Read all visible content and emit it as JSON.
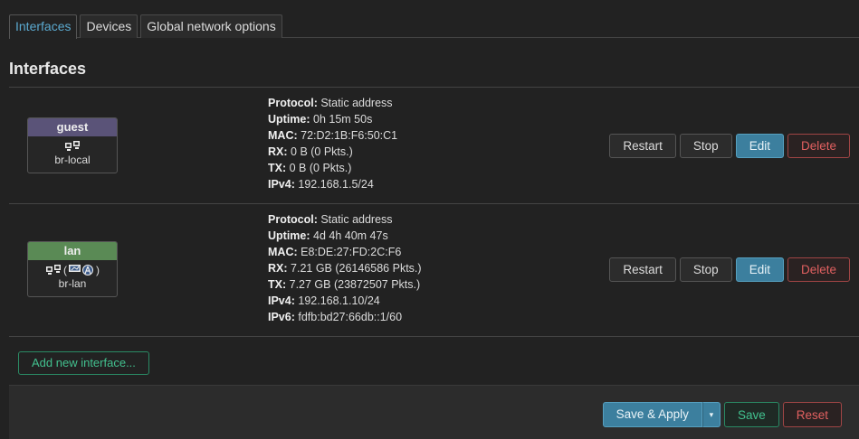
{
  "tabs": [
    {
      "label": "Interfaces",
      "active": true
    },
    {
      "label": "Devices",
      "active": false
    },
    {
      "label": "Global network options",
      "active": false
    }
  ],
  "section_title": "Interfaces",
  "interfaces": [
    {
      "name": "guest",
      "color": "#5a5378",
      "device": "br-local",
      "info": [
        {
          "label": "Protocol:",
          "value": "Static address"
        },
        {
          "label": "Uptime:",
          "value": "0h 15m 50s"
        },
        {
          "label": "MAC:",
          "value": "72:D2:1B:F6:50:C1"
        },
        {
          "label": "RX:",
          "value": "0 B (0 Pkts.)"
        },
        {
          "label": "TX:",
          "value": "0 B (0 Pkts.)"
        },
        {
          "label": "IPv4:",
          "value": "192.168.1.5/24"
        }
      ]
    },
    {
      "name": "lan",
      "color": "#5a8a55",
      "device": "br-lan",
      "info": [
        {
          "label": "Protocol:",
          "value": "Static address"
        },
        {
          "label": "Uptime:",
          "value": "4d 4h 40m 47s"
        },
        {
          "label": "MAC:",
          "value": "E8:DE:27:FD:2C:F6"
        },
        {
          "label": "RX:",
          "value": "7.21 GB (26146586 Pkts.)"
        },
        {
          "label": "TX:",
          "value": "7.27 GB (23872507 Pkts.)"
        },
        {
          "label": "IPv4:",
          "value": "192.168.1.10/24"
        },
        {
          "label": "IPv6:",
          "value": "fdfb:bd27:66db::1/60"
        }
      ]
    }
  ],
  "row_actions": {
    "restart": "Restart",
    "stop": "Stop",
    "edit": "Edit",
    "delete": "Delete"
  },
  "add_interface_label": "Add new interface...",
  "footer": {
    "save_apply": "Save & Apply",
    "caret": "▾",
    "save": "Save",
    "reset": "Reset"
  }
}
